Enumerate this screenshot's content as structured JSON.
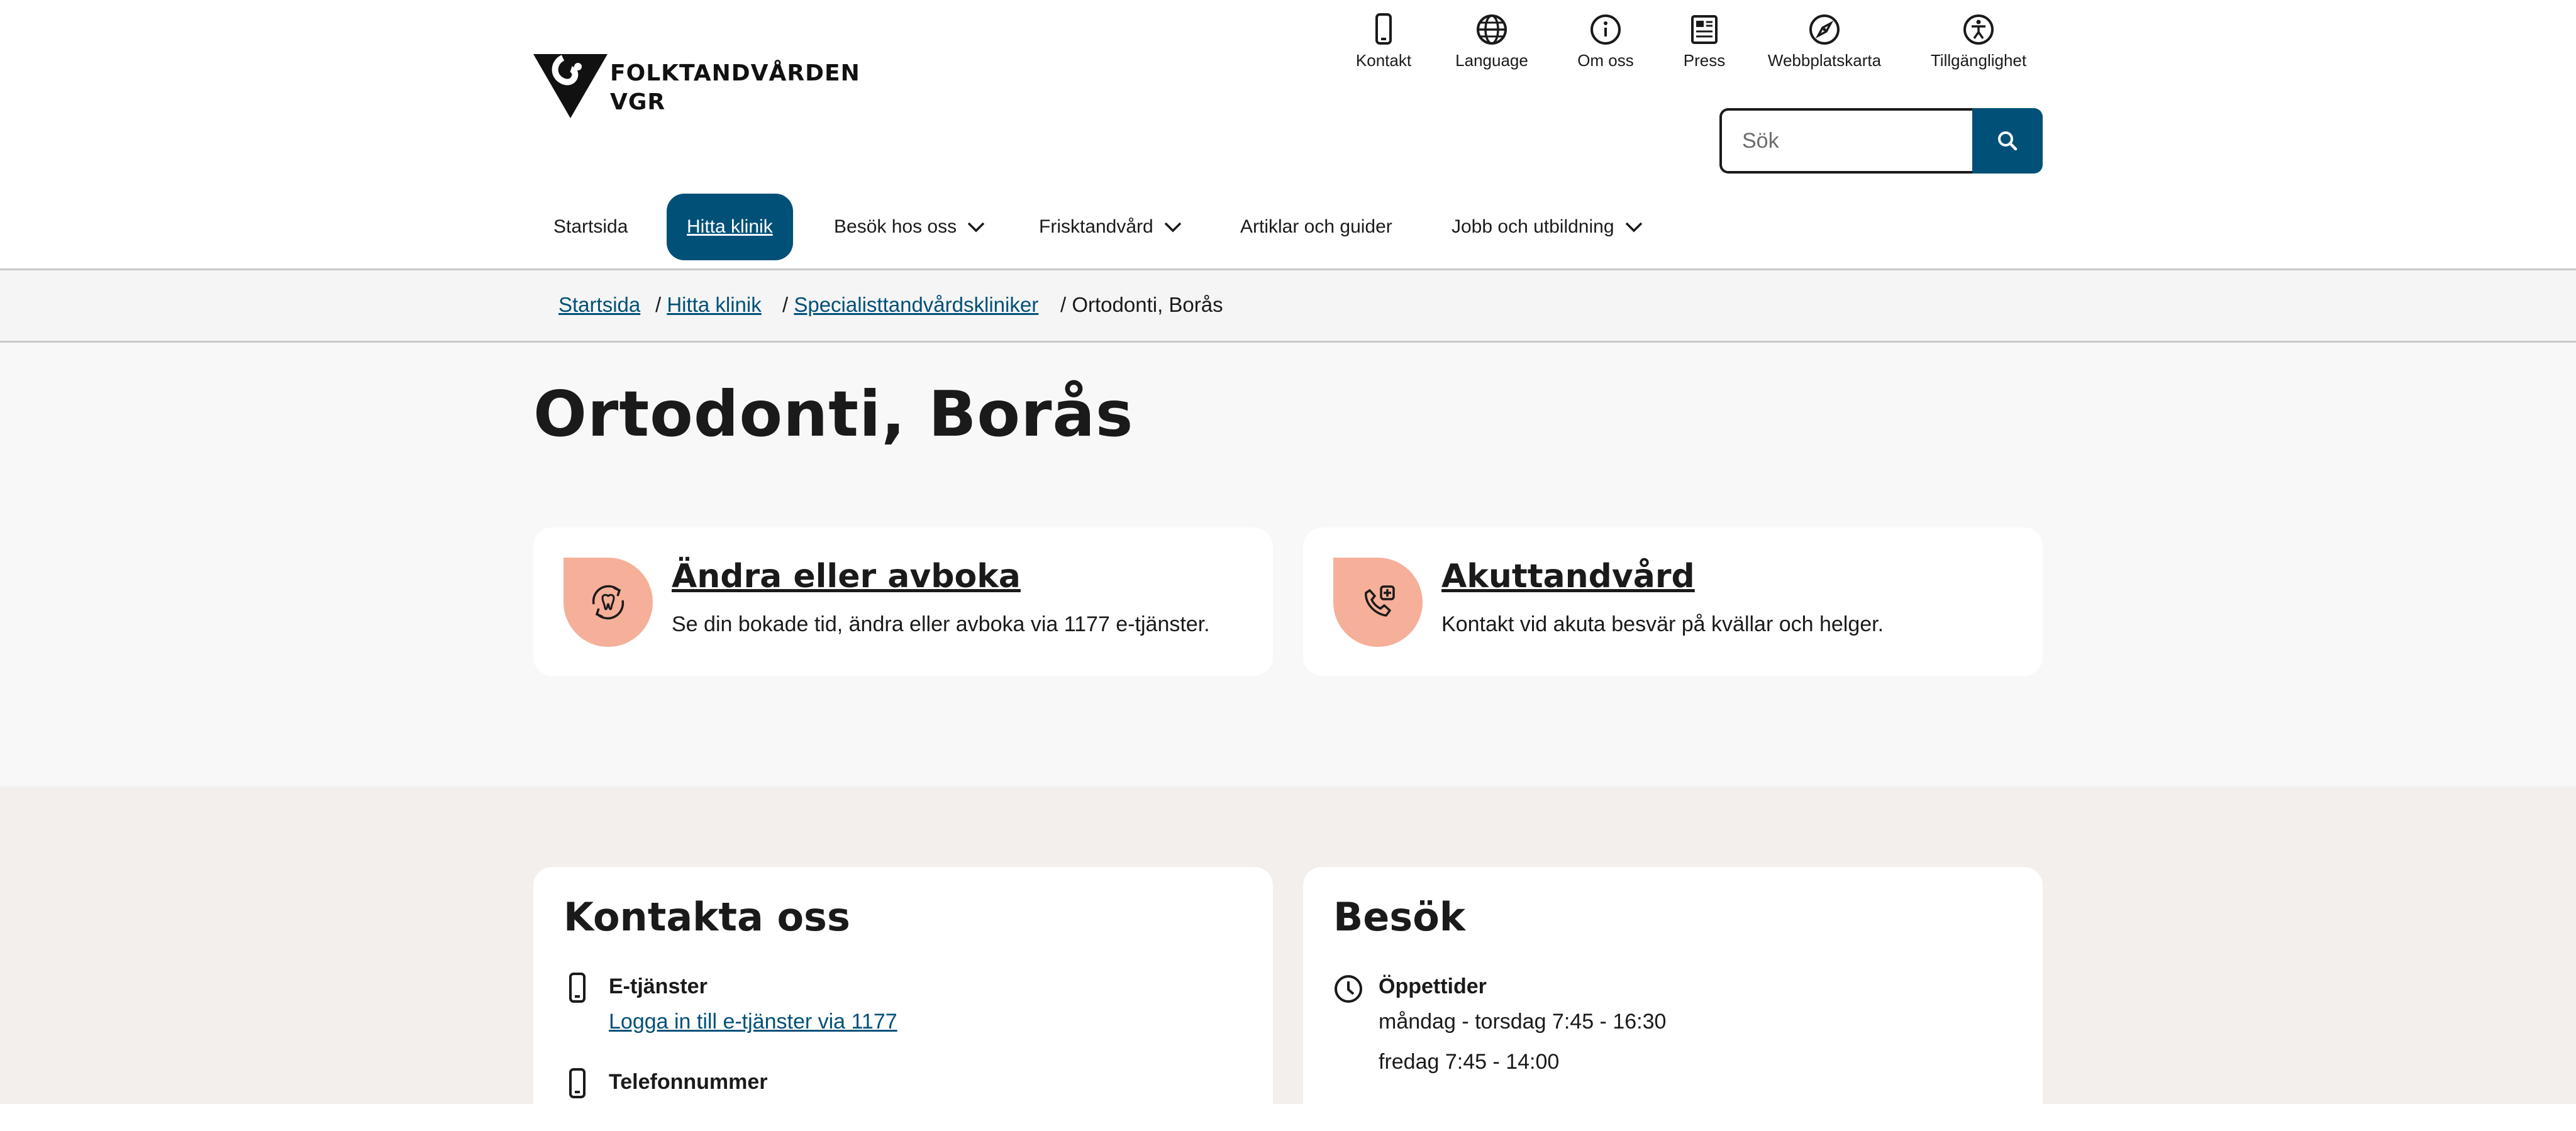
{
  "logo": {
    "line1": "FOLKTANDVÅRDEN",
    "line2": "VGR"
  },
  "util_nav": [
    {
      "label": "Kontakt",
      "icon": "phone-icon"
    },
    {
      "label": "Language",
      "icon": "globe-icon"
    },
    {
      "label": "Om oss",
      "icon": "info-icon"
    },
    {
      "label": "Press",
      "icon": "newspaper-icon"
    },
    {
      "label": "Webbplatskarta",
      "icon": "compass-icon"
    },
    {
      "label": "Tillgänglighet",
      "icon": "accessibility-icon"
    }
  ],
  "search": {
    "placeholder": "Sök"
  },
  "main_nav": [
    {
      "label": "Startsida"
    },
    {
      "label": "Hitta klinik"
    },
    {
      "label": "Besök hos oss"
    },
    {
      "label": "Frisktandvård"
    },
    {
      "label": "Artiklar och guider"
    },
    {
      "label": "Jobb och utbildning"
    }
  ],
  "breadcrumb": [
    {
      "label": "Startsida"
    },
    {
      "label": "Hitta klinik"
    },
    {
      "label": "Specialisttandvårdskliniker"
    },
    {
      "label": "Ortodonti, Borås"
    }
  ],
  "page_title": "Ortodonti, Borås",
  "cards": [
    {
      "title": "Ändra eller avboka",
      "desc": "Se din bokade tid, ändra eller avboka via 1177 e-tjänster.",
      "icon": "tooth-refresh-icon"
    },
    {
      "title": "Akuttandvård",
      "desc": "Kontakt vid akuta besvär på kvällar och helger.",
      "icon": "phone-plus-icon"
    }
  ],
  "contact": {
    "heading": "Kontakta oss",
    "etjanster_title": "E-tjänster",
    "etjanster_link": "Logga in till e-tjänster via 1177",
    "phone_title": "Telefonnummer"
  },
  "visit": {
    "heading": "Besök",
    "hours_title": "Öppettider",
    "hours": [
      "måndag - torsdag 7:45 - 16:30",
      "fredag 7:45 - 14:00"
    ]
  },
  "colors": {
    "primary": "#005078",
    "accent_badge": "#f6af99",
    "info_bg": "#f3efed"
  }
}
